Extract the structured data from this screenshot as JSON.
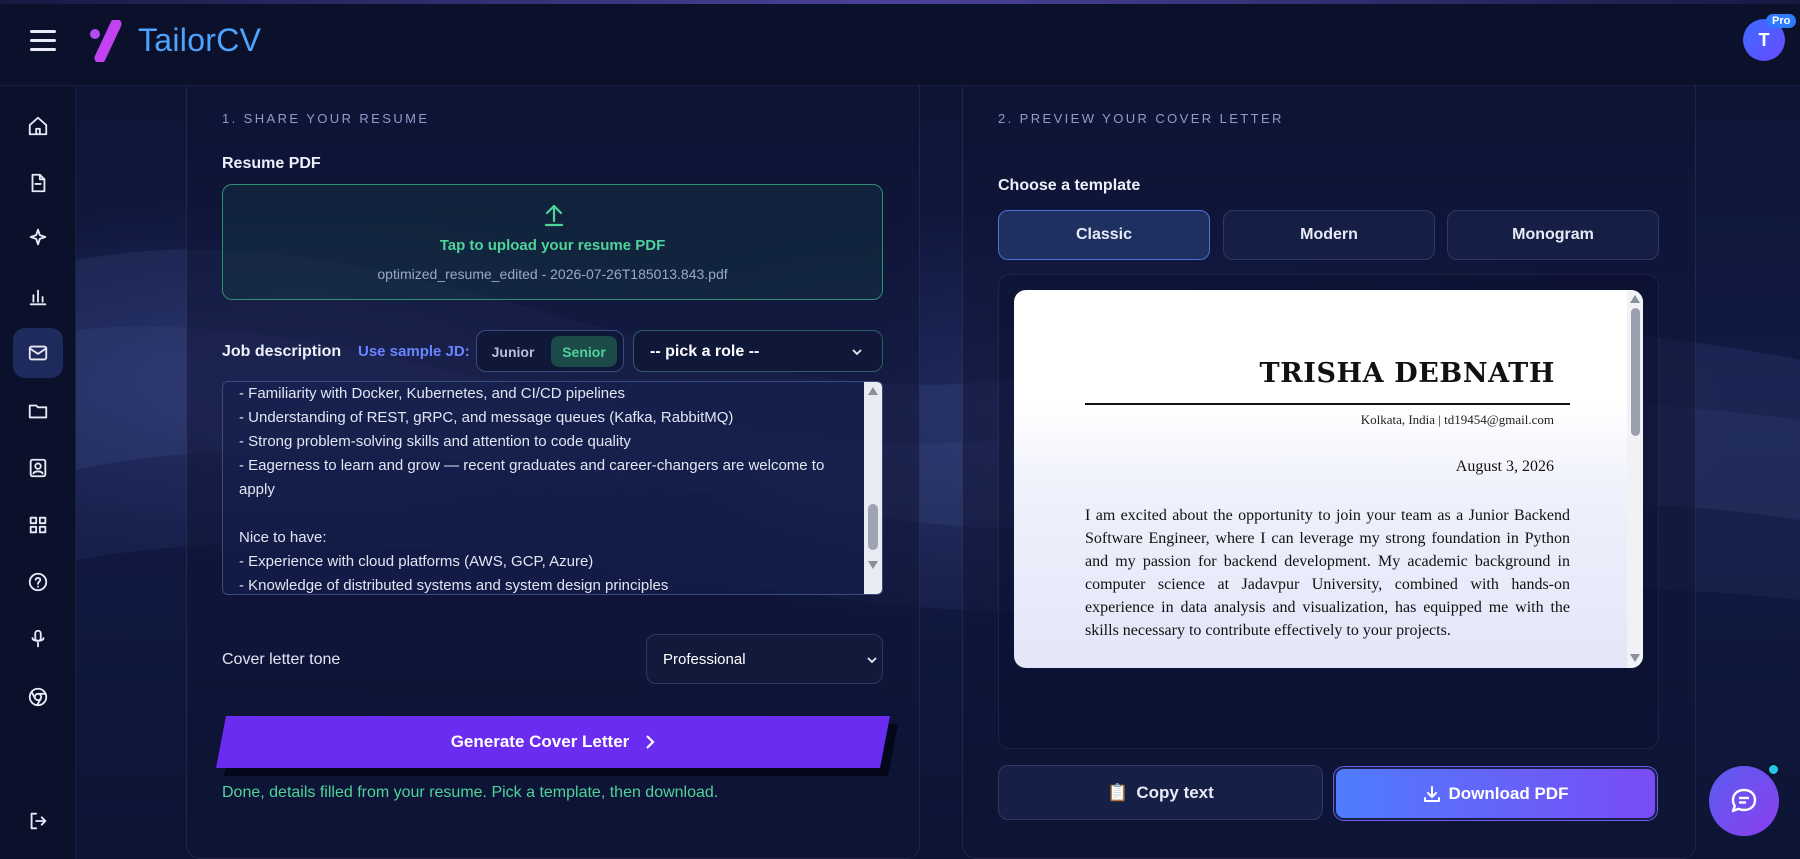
{
  "app": {
    "name": "TailorCV"
  },
  "user": {
    "initial": "T",
    "badge": "Pro"
  },
  "sidebar": {
    "items": [
      {
        "icon": "home-icon"
      },
      {
        "icon": "document-icon"
      },
      {
        "icon": "sparkle-icon"
      },
      {
        "icon": "bar-chart-icon"
      },
      {
        "icon": "mail-icon",
        "active": true
      },
      {
        "icon": "folder-icon"
      },
      {
        "icon": "contact-card-icon"
      },
      {
        "icon": "grid-icon"
      },
      {
        "icon": "help-icon"
      },
      {
        "icon": "microphone-icon"
      },
      {
        "icon": "chrome-icon"
      },
      {
        "icon": "logout-icon"
      }
    ]
  },
  "left": {
    "section_title": "1. SHARE YOUR RESUME",
    "resume_label": "Resume PDF",
    "upload": {
      "title": "Tap to upload your resume PDF",
      "filename": "optimized_resume_edited - 2026-07-26T185013.843.pdf"
    },
    "jd_label": "Job description",
    "sample_label": "Use sample JD:",
    "levels": [
      "Junior",
      "Senior"
    ],
    "selected_level": "Senior",
    "role_select": "-- pick a role --",
    "jd_lines": [
      "- Familiarity with Docker, Kubernetes, and CI/CD pipelines",
      "- Understanding of REST, gRPC, and message queues (Kafka, RabbitMQ)",
      "- Strong problem-solving skills and attention to code quality",
      "- Eagerness to learn and grow — recent graduates and career-changers are welcome to",
      "apply",
      "",
      "Nice to have:",
      "- Experience with cloud platforms (AWS, GCP, Azure)",
      "- Knowledge of distributed systems and system design principles"
    ],
    "tone_label": "Cover letter tone",
    "tone_value": "Professional",
    "generate_label": "Generate Cover Letter",
    "status": "Done, details filled from your resume. Pick a template, then download."
  },
  "right": {
    "section_title": "2. PREVIEW YOUR COVER LETTER",
    "template_label": "Choose a template",
    "templates": [
      "Classic",
      "Modern",
      "Monogram"
    ],
    "selected_template": "Classic",
    "letter": {
      "name": "TRISHA DEBNATH",
      "contact": "Kolkata, India | td19454@gmail.com",
      "date": "August 3, 2026",
      "body": "I am excited about the opportunity to join your team as a Junior Backend Software Engineer, where I can leverage my strong foundation in Python and my passion for backend development. My academic background in computer science at Jadavpur University, combined with hands-on experience in data analysis and visualization, has equipped me with the skills necessary to contribute effectively to your projects."
    },
    "copy_label": "Copy text",
    "download_label": "Download PDF"
  },
  "colors": {
    "accent_green": "#4ed39a",
    "accent_purple": "#6a2cf0",
    "brand_blue": "#4ea3ff"
  }
}
